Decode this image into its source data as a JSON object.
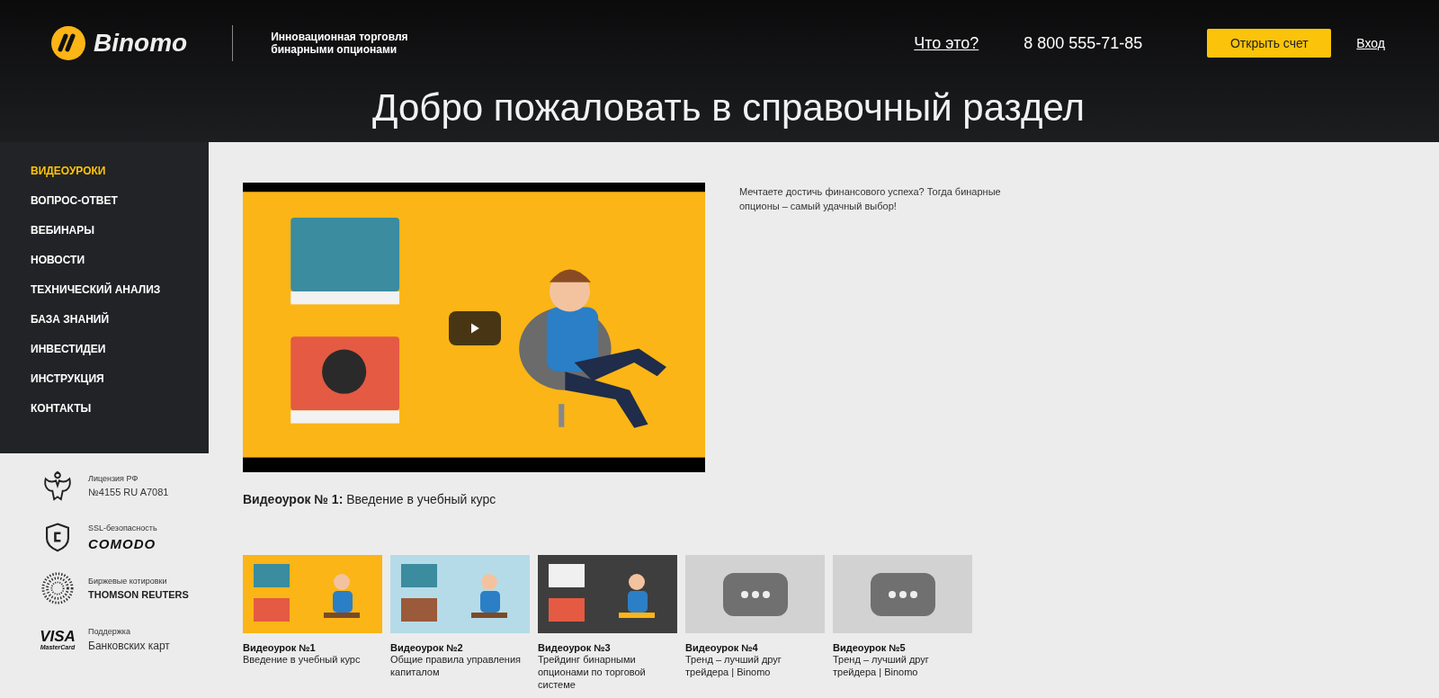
{
  "header": {
    "logo": "Binomo",
    "tagline": "Инновационная торговля бинарными опционами",
    "about_link": "Что это?",
    "phone": "8 800 555-71-85",
    "open_account_button": "Открыть счет",
    "login_link": "Вход",
    "title": "Добро пожаловать в справочный раздел"
  },
  "sidebar": {
    "items": [
      {
        "label": "ВИДЕОУРОКИ",
        "selected": true
      },
      {
        "label": "ВОПРОС-ОТВЕТ",
        "selected": false
      },
      {
        "label": "ВЕБИНАРЫ",
        "selected": false
      },
      {
        "label": "НОВОСТИ",
        "selected": false
      },
      {
        "label": "ТЕХНИЧЕСКИЙ АНАЛИЗ",
        "selected": false
      },
      {
        "label": "БАЗА ЗНАНИЙ",
        "selected": false
      },
      {
        "label": "ИНВЕСТИДЕИ",
        "selected": false
      },
      {
        "label": "ИНСТРУКЦИЯ",
        "selected": false
      },
      {
        "label": "КОНТАКТЫ",
        "selected": false
      }
    ],
    "badges": [
      {
        "kind": "emblem",
        "caption": "Лицензия РФ",
        "value": "№4155 RU A7081"
      },
      {
        "kind": "shield",
        "caption": "SSL-безопасность",
        "value": "COMODO"
      },
      {
        "kind": "dots",
        "caption": "Биржевые котировки",
        "value": "THOMSON REUTERS"
      },
      {
        "kind": "cards",
        "logo": "VISA",
        "sublogo": "MasterCard",
        "caption": "Поддержка",
        "value": "Банковских карт"
      }
    ]
  },
  "video": {
    "caption_label": "Видеоурок № 1:",
    "caption": "Введение в учебный курс"
  },
  "intro": "Мечтаете достичь финансового успеха? Тогда бинарные опционы – самый удачный выбор!",
  "lessons": [
    {
      "kind": "picture",
      "title": "Видеоурок №1",
      "subtitle": "Введение в учебный курс"
    },
    {
      "kind": "picture",
      "title": "Видеоурок №2",
      "subtitle": "Общие правила управления капиталом"
    },
    {
      "kind": "picture",
      "title": "Видеоурок №3",
      "subtitle": "Трейдинг бинарными опционами по торговой системе"
    },
    {
      "kind": "placeholder",
      "title": "Видеоурок №4",
      "subtitle": "Тренд – лучший друг трейдера | Binomo"
    },
    {
      "kind": "placeholder",
      "title": "Видеоурок №5",
      "subtitle": "Тренд – лучший друг трейдера | Binomo"
    }
  ]
}
